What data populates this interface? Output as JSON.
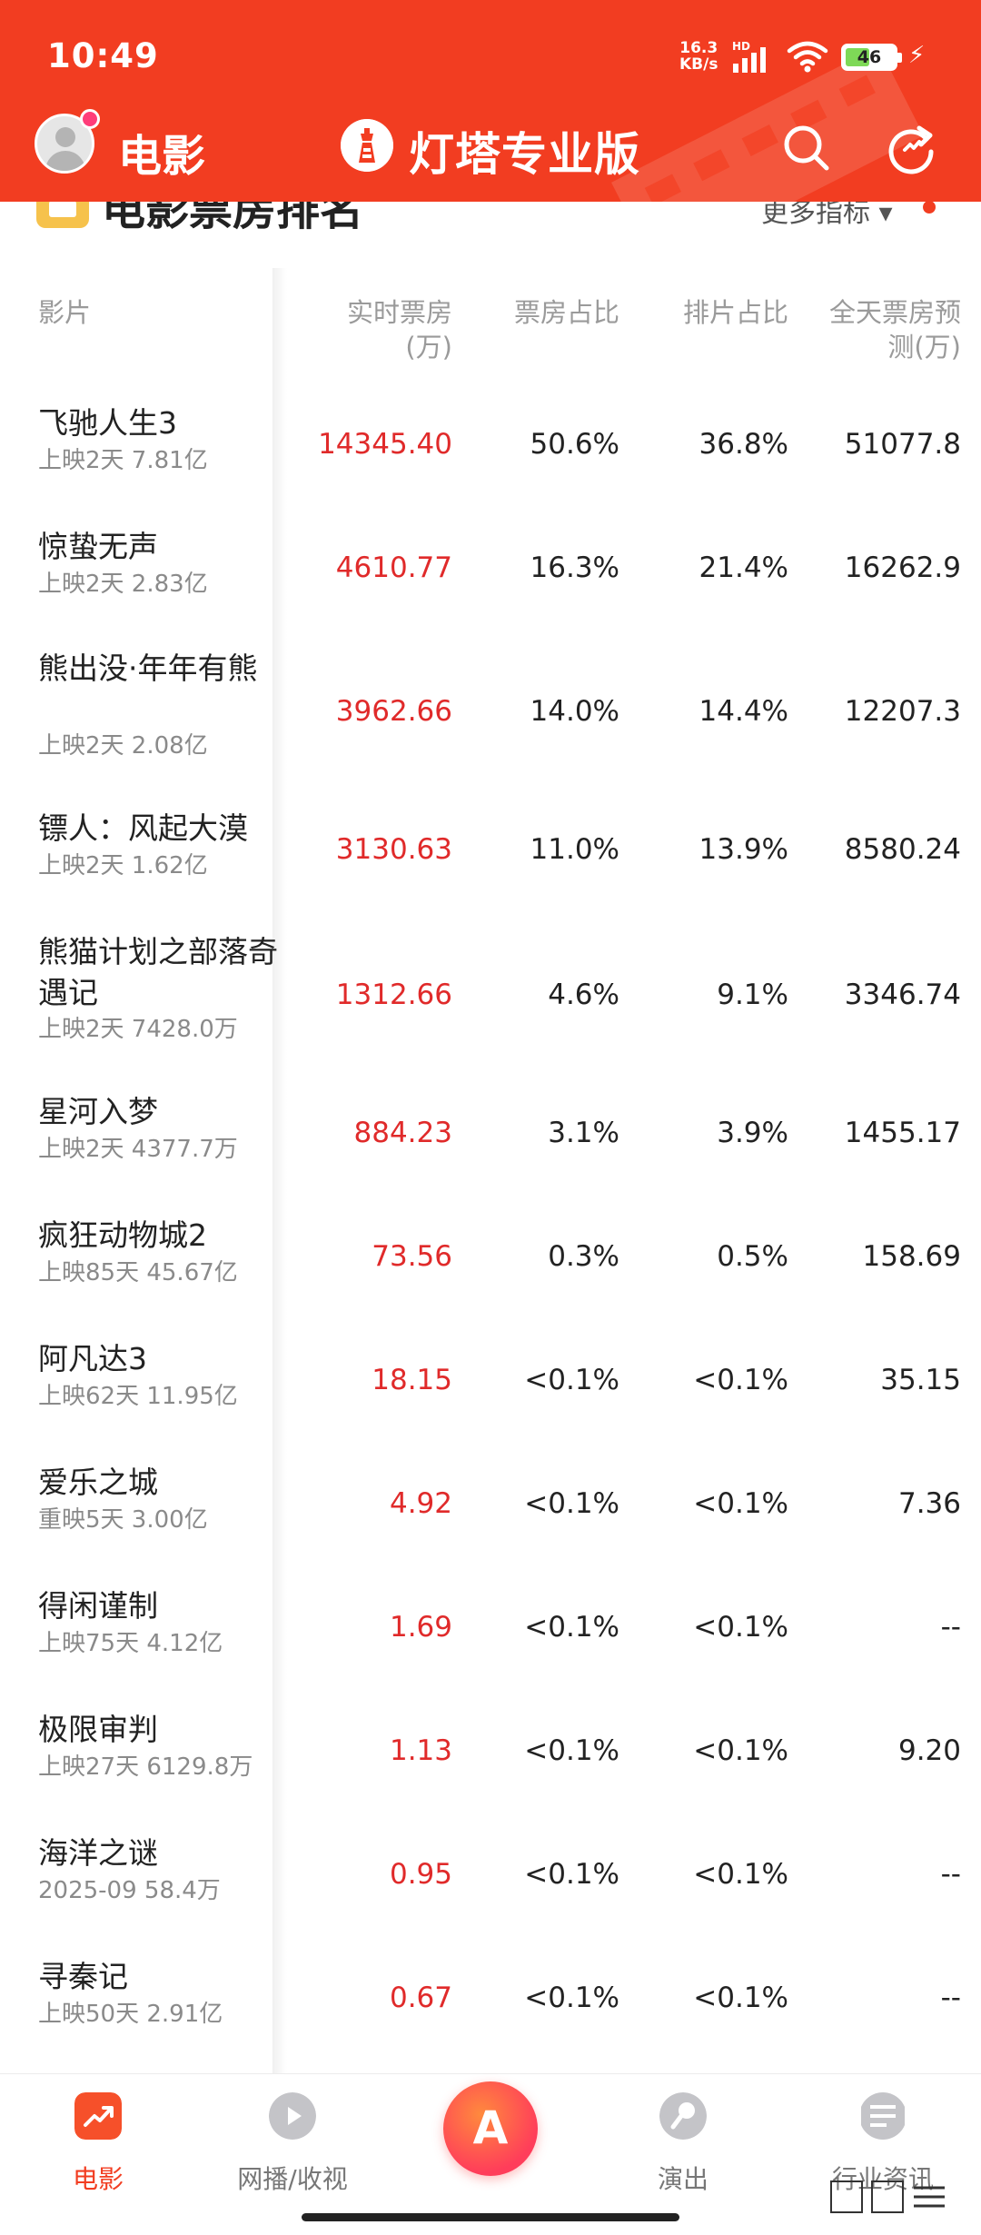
{
  "status_bar": {
    "time": "10:49",
    "net_speed": "16.3",
    "net_unit": "KB/s",
    "hd": "HD",
    "battery": "46",
    "battery_fill": 0.46
  },
  "header": {
    "section_title": "电影",
    "brand_name": "灯塔专业版",
    "icons": [
      "avatar",
      "search-icon",
      "refresh-icon"
    ],
    "bg_color": "#f23d21"
  },
  "ranking": {
    "title": "电影票房排名",
    "more_metrics": "更多指标",
    "more_arrow": "▾"
  },
  "table": {
    "headers": {
      "film": "影片",
      "realtime": "实时票房",
      "realtime_unit": "(万)",
      "share": "票房占比",
      "schedule": "排片占比",
      "forecast": "全天票房预",
      "forecast_unit": "测(万)"
    },
    "rows": [
      {
        "name": "飞驰人生3",
        "meta": "上映2天 7.81亿",
        "realtime": "14345.40",
        "share": "50.6%",
        "schedule": "36.8%",
        "forecast": "51077.8"
      },
      {
        "name": "惊蛰无声",
        "meta": "上映2天 2.83亿",
        "realtime": "4610.77",
        "share": "16.3%",
        "schedule": "21.4%",
        "forecast": "16262.9"
      },
      {
        "name": "熊出没·年年有熊",
        "meta": "上映2天 2.08亿",
        "realtime": "3962.66",
        "share": "14.0%",
        "schedule": "14.4%",
        "forecast": "12207.3"
      },
      {
        "name": "镖人：风起大漠",
        "meta": "上映2天 1.62亿",
        "realtime": "3130.63",
        "share": "11.0%",
        "schedule": "13.9%",
        "forecast": "8580.24"
      },
      {
        "name": "熊猫计划之部落奇遇记",
        "meta": "上映2天 7428.0万",
        "realtime": "1312.66",
        "share": "4.6%",
        "schedule": "9.1%",
        "forecast": "3346.74"
      },
      {
        "name": "星河入梦",
        "meta": "上映2天 4377.7万",
        "realtime": "884.23",
        "share": "3.1%",
        "schedule": "3.9%",
        "forecast": "1455.17"
      },
      {
        "name": "疯狂动物城2",
        "meta": "上映85天 45.67亿",
        "realtime": "73.56",
        "share": "0.3%",
        "schedule": "0.5%",
        "forecast": "158.69"
      },
      {
        "name": "阿凡达3",
        "meta": "上映62天 11.95亿",
        "realtime": "18.15",
        "share": "<0.1%",
        "schedule": "<0.1%",
        "forecast": "35.15"
      },
      {
        "name": "爱乐之城",
        "meta": "重映5天 3.00亿",
        "realtime": "4.92",
        "share": "<0.1%",
        "schedule": "<0.1%",
        "forecast": "7.36"
      },
      {
        "name": "得闲谨制",
        "meta": "上映75天 4.12亿",
        "realtime": "1.69",
        "share": "<0.1%",
        "schedule": "<0.1%",
        "forecast": "--"
      },
      {
        "name": "极限审判",
        "meta": "上映27天 6129.8万",
        "realtime": "1.13",
        "share": "<0.1%",
        "schedule": "<0.1%",
        "forecast": "9.20"
      },
      {
        "name": "海洋之谜",
        "meta": "2025-09 58.4万",
        "realtime": "0.95",
        "share": "<0.1%",
        "schedule": "<0.1%",
        "forecast": "--"
      },
      {
        "name": "寻秦记",
        "meta": "上映50天 2.91亿",
        "realtime": "0.67",
        "share": "<0.1%",
        "schedule": "<0.1%",
        "forecast": "--"
      }
    ]
  },
  "bottom_nav": {
    "items": [
      {
        "label": "电影",
        "icon": "trend-icon",
        "active": true
      },
      {
        "label": "网播/收视",
        "icon": "play-icon",
        "active": false
      },
      {
        "label": "",
        "icon": "center-logo-icon",
        "active": false
      },
      {
        "label": "演出",
        "icon": "microphone-icon",
        "active": false
      },
      {
        "label": "行业资讯",
        "icon": "news-icon",
        "active": false
      }
    ],
    "active_color": "#f23d21"
  }
}
